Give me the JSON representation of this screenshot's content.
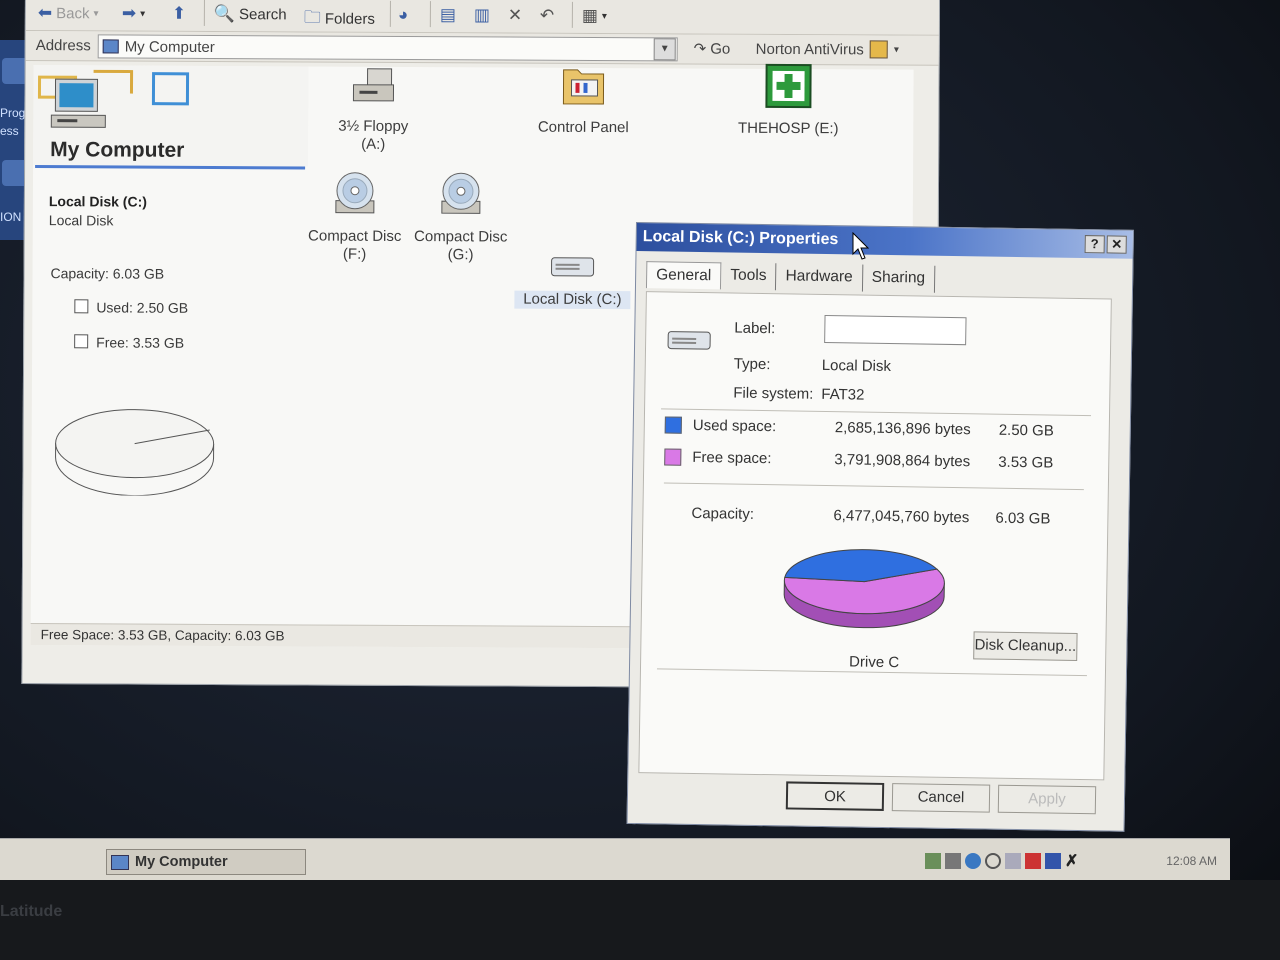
{
  "desktop": {
    "labels": [
      "Prog",
      "ess",
      "ION"
    ]
  },
  "explorer": {
    "toolbar": {
      "back_label": "Back",
      "search_label": "Search",
      "folders_label": "Folders"
    },
    "address": {
      "label": "Address",
      "value": "My Computer",
      "go_label": "Go",
      "antivirus_label": "Norton AntiVirus"
    },
    "left_pane": {
      "title": "My Computer",
      "selected_name": "Local Disk (C:)",
      "selected_type": "Local Disk",
      "capacity": "Capacity: 6.03 GB",
      "used": "Used: 2.50 GB",
      "free": "Free: 3.53 GB"
    },
    "items": [
      {
        "line1": "3½ Floppy",
        "line2": "(A:)"
      },
      {
        "line1": "Control Panel",
        "line2": ""
      },
      {
        "line1": "THEHOSP (E:)",
        "line2": ""
      },
      {
        "line1": "Compact Disc",
        "line2": "(F:)"
      },
      {
        "line1": "Compact Disc",
        "line2": "(G:)"
      },
      {
        "line1": "Local Disk (C:)",
        "line2": ""
      }
    ],
    "status_text": "Free Space: 3.53 GB, Capacity: 6.03 GB"
  },
  "props": {
    "title": "Local Disk (C:) Properties",
    "help_btn": "?",
    "close_btn": "✕",
    "tabs": [
      "General",
      "Tools",
      "Hardware",
      "Sharing"
    ],
    "label_label": "Label:",
    "label_value": "",
    "type_label": "Type:",
    "type_value": "Local Disk",
    "fs_label": "File system:",
    "fs_value": "FAT32",
    "used_label": "Used space:",
    "used_bytes": "2,685,136,896 bytes",
    "used_gb": "2.50 GB",
    "free_label": "Free space:",
    "free_bytes": "3,791,908,864 bytes",
    "free_gb": "3.53 GB",
    "cap_label": "Capacity:",
    "cap_bytes": "6,477,045,760 bytes",
    "cap_gb": "6.03 GB",
    "drive_label": "Drive C",
    "cleanup_btn": "Disk Cleanup...",
    "ok_btn": "OK",
    "cancel_btn": "Cancel",
    "apply_btn": "Apply",
    "used_fraction": 0.4146,
    "colors": {
      "used": "#2f6fe0",
      "free": "#d979e6"
    }
  },
  "taskbar": {
    "task_label": "My Computer",
    "clock": "12:08 AM"
  },
  "bezel": {
    "brand": "Latitude"
  }
}
